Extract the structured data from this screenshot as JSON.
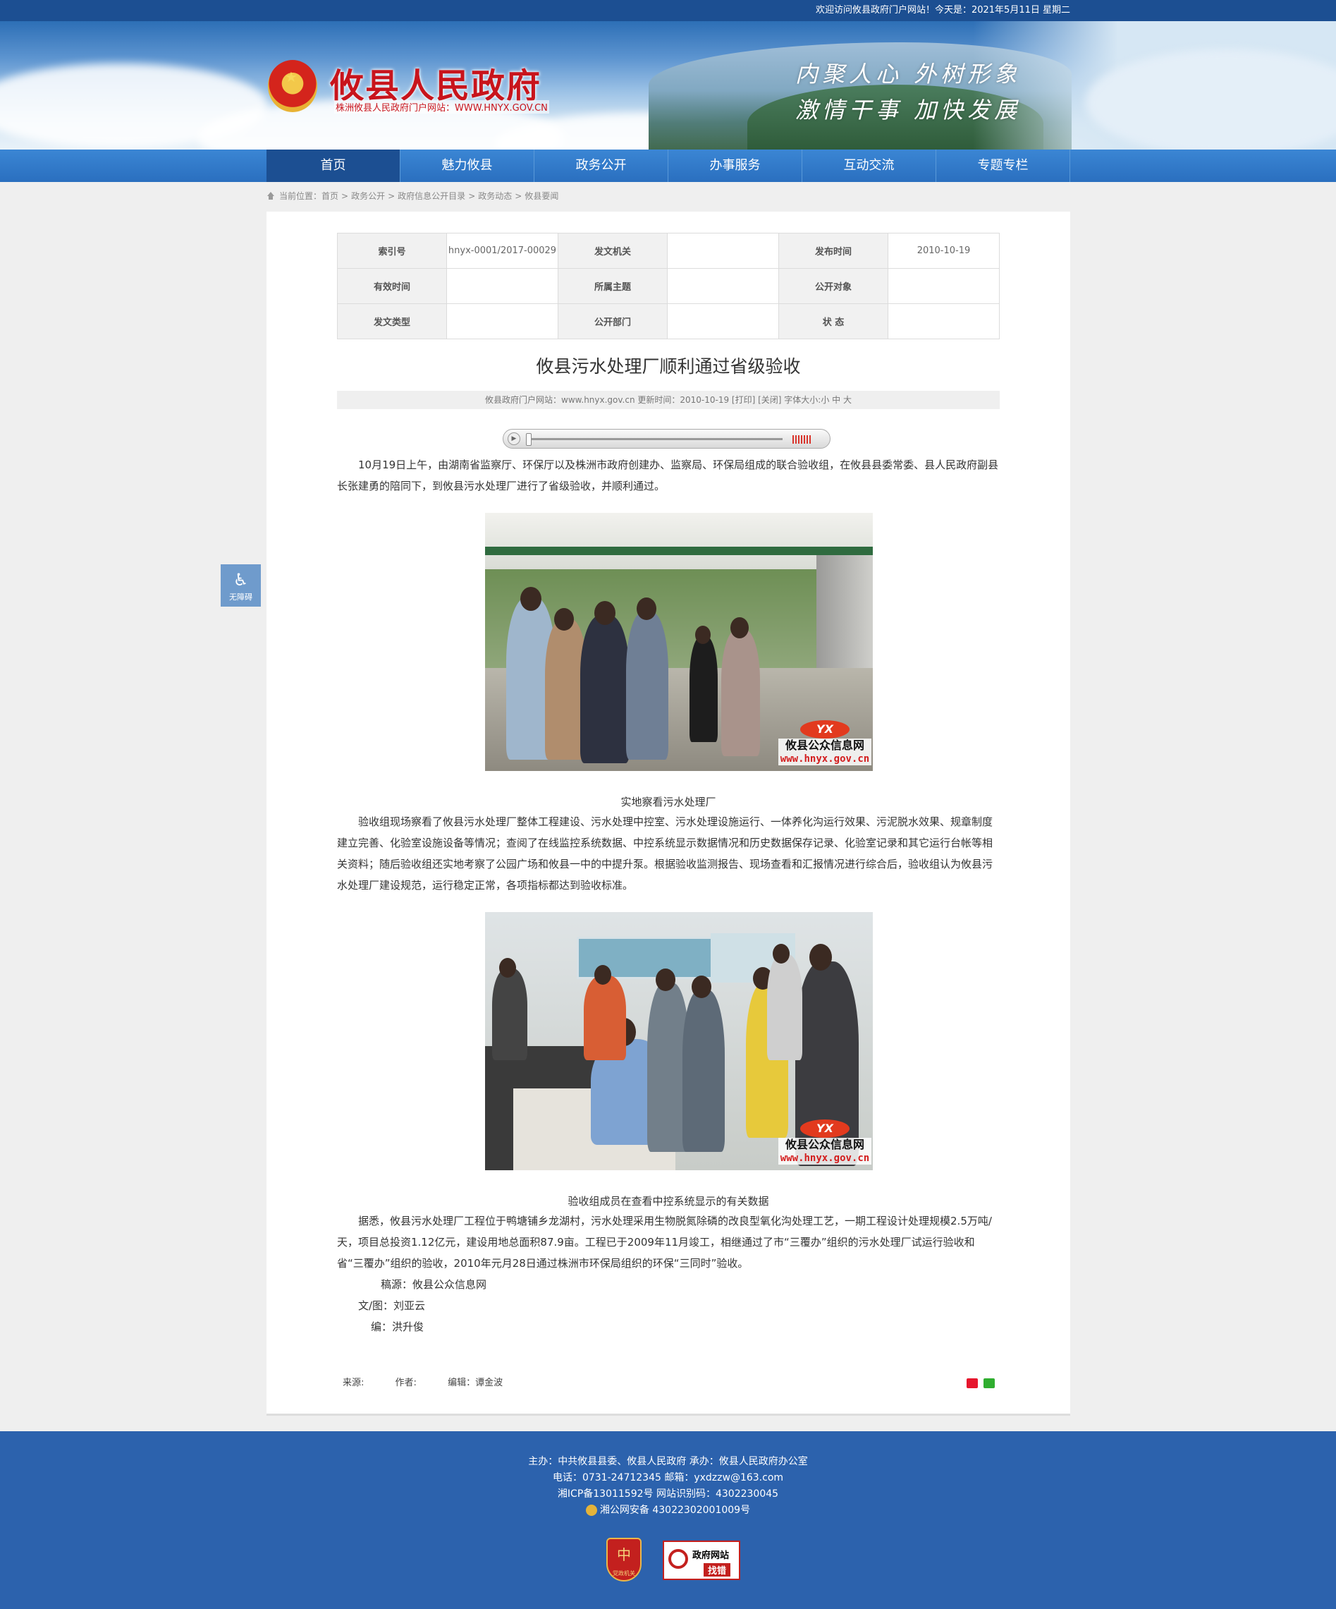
{
  "topbar": {
    "welcome": "欢迎访问攸县政府门户网站！今天是：2021年5月11日 星期二"
  },
  "header": {
    "site_name": "攸县人民政府",
    "site_subtitle": "株洲攸县人民政府门户网站：WWW.HNYX.GOV.CN",
    "slogan_line1": "内聚人心  外树形象",
    "slogan_line2": "激情干事  加快发展"
  },
  "nav": [
    {
      "label": "首页",
      "active": true
    },
    {
      "label": "魅力攸县"
    },
    {
      "label": "政务公开"
    },
    {
      "label": "办事服务"
    },
    {
      "label": "互动交流"
    },
    {
      "label": "专题专栏"
    }
  ],
  "breadcrumb": {
    "prefix": "当前位置：",
    "items": [
      "首页",
      "政务公开",
      "政府信息公开目录",
      "政务动态",
      "攸县要闻"
    ],
    "separator": ">"
  },
  "meta_table": {
    "row1": {
      "k1": "索引号",
      "v1": "hnyx-0001/2017-00029",
      "k2": "发文机关",
      "v2": "",
      "k3": "发布时间",
      "v3": "2010-10-19"
    },
    "row2": {
      "k1": "有效时间",
      "v1": "",
      "k2": "所属主题",
      "v2": "",
      "k3": "公开对象",
      "v3": ""
    },
    "row3": {
      "k1": "发文类型",
      "v1": "",
      "k2": "公开部门",
      "v2": "",
      "k3": "状 态",
      "v3": ""
    }
  },
  "article": {
    "title": "攸县污水处理厂顺利通过省级验收",
    "info": "攸县政府门户网站：www.hnyx.gov.cn   更新时间：2010-10-19  [打印] [关闭]   字体大小:小 中 大",
    "para1": "10月19日上午，由湖南省监察厅、环保厅以及株洲市政府创建办、监察局、环保局组成的联合验收组，在攸县县委常委、县人民政府副县长张建勇的陪同下，到攸县污水处理厂进行了省级验收，并顺利通过。",
    "caption1": "实地察看污水处理厂",
    "para2": "验收组现场察看了攸县污水处理厂整体工程建设、污水处理中控室、污水处理设施运行、一体养化沟运行效果、污泥脱水效果、规章制度建立完善、化验室设施设备等情况；查阅了在线监控系统数据、中控系统显示数据情况和历史数据保存记录、化验室记录和其它运行台帐等相关资料；随后验收组还实地考察了公园广场和攸县一中的中提升泵。根据验收监测报告、现场查看和汇报情况进行综合后，验收组认为攸县污水处理厂建设规范，运行稳定正常，各项指标都达到验收标准。",
    "caption2": "验收组成员在查看中控系统显示的有关数据",
    "para3": "据悉，攸县污水处理厂工程位于鸭塘铺乡龙湖村，污水处理采用生物脱氮除磷的改良型氧化沟处理工艺，一期工程设计处理规模2.5万吨/天，项目总投资1.12亿元，建设用地总面积87.9亩。工程已于2009年11月竣工，相继通过了市“三覆办”组织的污水处理厂试运行验收和省“三覆办”组织的验收，2010年元月28日通过株洲市环保局组织的环保“三同时”验收。",
    "sign_source": "稿源：攸县公众信息网",
    "sign_author": "文/图：刘亚云",
    "sign_editor": "编：洪升俊",
    "watermark_logo": "YX",
    "watermark_line1": "攸县公众信息网",
    "watermark_line2": "www.hnyx.gov.cn"
  },
  "article_footer": {
    "source": "来源:",
    "author": "作者:",
    "editor": "编辑：谭金波"
  },
  "accessibility": {
    "label": "无障碍"
  },
  "footer": {
    "line1": "主办：中共攸县县委、攸县人民政府 承办：攸县人民政府办公室",
    "line2": "电话：0731-24712345 邮箱：yxdzzw@163.com",
    "line3": "湘ICP备13011592号   网站识别码：4302230045",
    "line4": "湘公网安备 43022302001009号",
    "badge1_glyph": "中",
    "badge1_text": "党政机关",
    "badge2_line1": "政府网站",
    "badge2_line2": "找错"
  }
}
